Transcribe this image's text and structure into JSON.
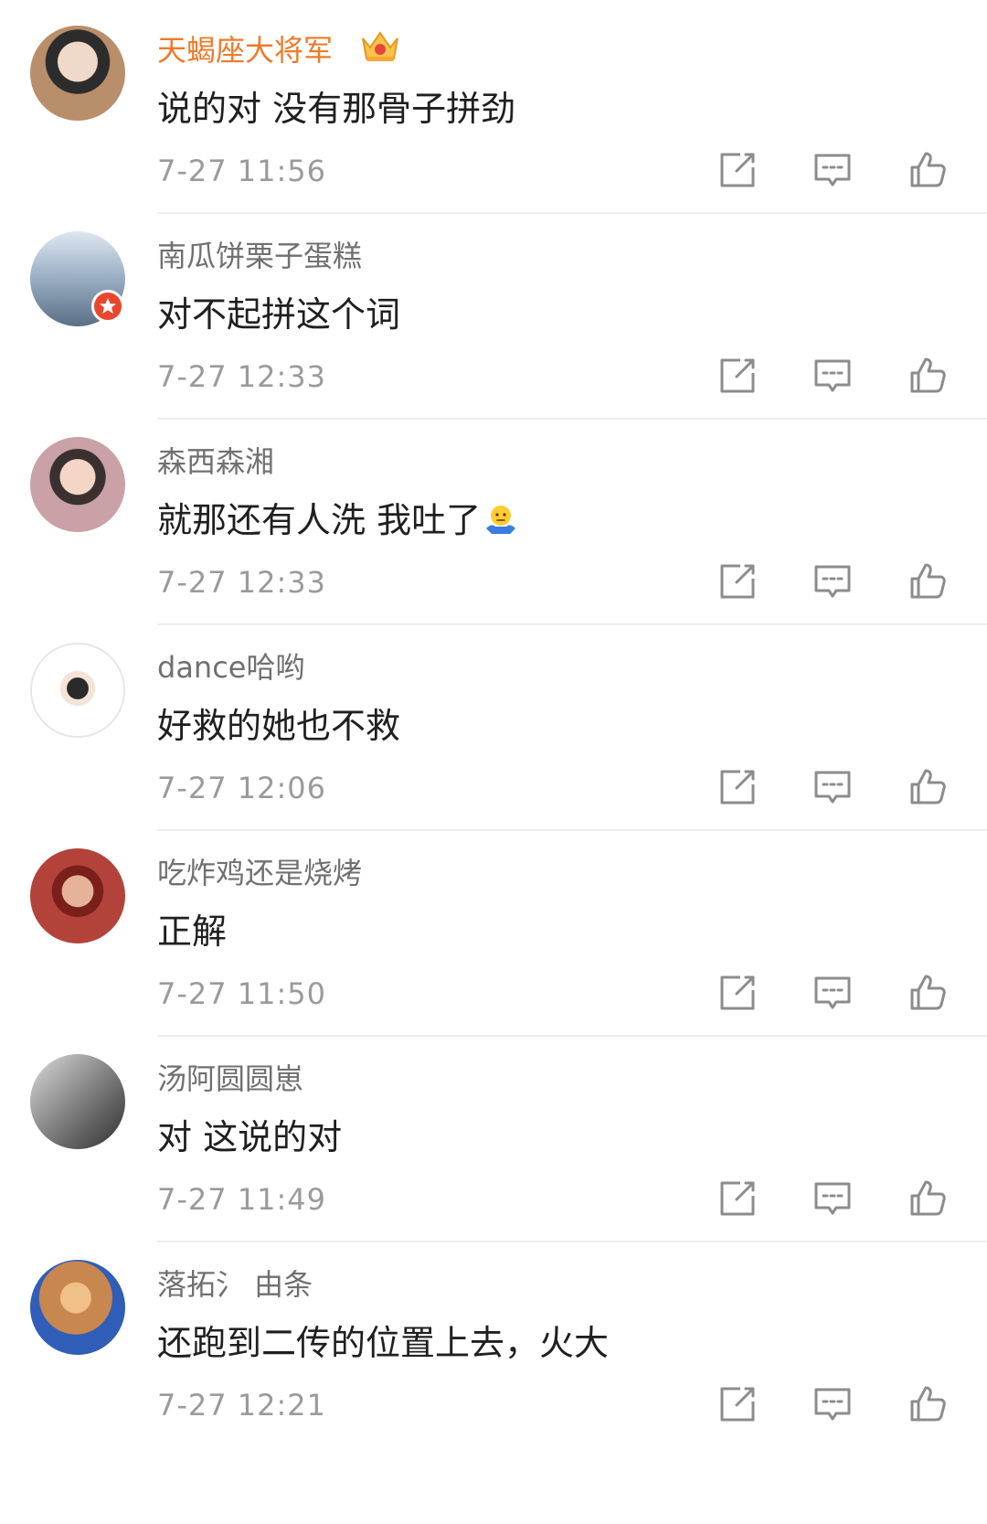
{
  "comments": [
    {
      "username": "天蝎座大将军",
      "text": "说的对 没有那骨子拼劲",
      "time": "7-27 11:56",
      "vip": true,
      "avatar_color": "#b98e6a"
    },
    {
      "username": "南瓜饼栗子蛋糕",
      "text": "对不起拼这个词",
      "time": "7-27 12:33",
      "verified": true,
      "avatar_color": "#8fa6bf"
    },
    {
      "username": "森西森湘",
      "text": "就那还有人洗 我吐了",
      "time": "7-27 12:33",
      "emoji": "shrug-emoji",
      "avatar_color": "#c9a1a6"
    },
    {
      "username": "dance哈哟",
      "text": "好救的她也不救",
      "time": "7-27 12:06",
      "avatar_color": "#f2f2f2"
    },
    {
      "username": "吃炸鸡还是烧烤",
      "text": "正解",
      "time": "7-27 11:50",
      "avatar_color": "#b3433a"
    },
    {
      "username": "汤阿圆圆崽",
      "text": "对 这说的对",
      "time": "7-27 11:49",
      "avatar_color": "#8a8a8a"
    },
    {
      "username": "落拓氵 由条",
      "text": "还跑到二传的位置上去，火大",
      "time": "7-27 12:21",
      "avatar_color": "#c8874f"
    }
  ],
  "colors": {
    "vip_name": "#f07a2a",
    "name": "#707070",
    "text": "#1f1f1f",
    "time": "#9a9a9a",
    "icon": "#8c8c8c",
    "divider": "#eeeeee",
    "verified_badge": "#e8462e"
  },
  "icons": [
    "repost-icon",
    "comment-icon",
    "like-icon",
    "vip-crown-icon",
    "verified-badge-icon"
  ]
}
